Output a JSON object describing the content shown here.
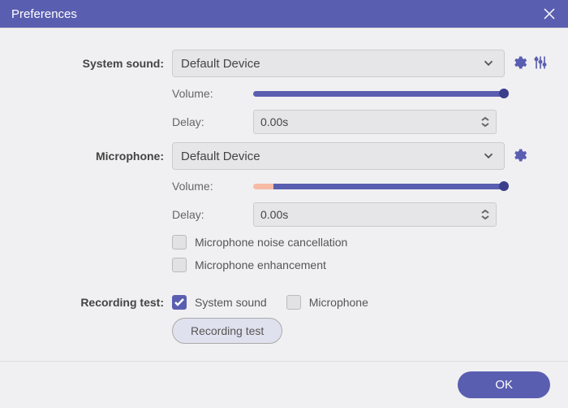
{
  "title": "Preferences",
  "system_sound": {
    "label": "System sound:",
    "device": "Default Device",
    "volume_label": "Volume:",
    "delay_label": "Delay:",
    "delay_value": "0.00s"
  },
  "microphone": {
    "label": "Microphone:",
    "device": "Default Device",
    "volume_label": "Volume:",
    "delay_label": "Delay:",
    "delay_value": "0.00s",
    "noise_cancel_label": "Microphone noise cancellation",
    "enhancement_label": "Microphone enhancement"
  },
  "recording_test": {
    "label": "Recording test:",
    "system_sound_label": "System sound",
    "system_sound_checked": true,
    "microphone_label": "Microphone",
    "microphone_checked": false,
    "button_label": "Recording test"
  },
  "ok_label": "OK"
}
